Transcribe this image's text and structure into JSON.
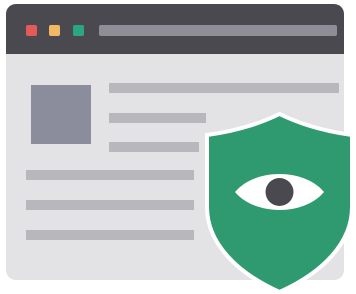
{
  "colors": {
    "window_bg": "#e3e3e6",
    "titlebar_bg": "#4a494f",
    "close_dot": "#e45a59",
    "minimize_dot": "#f2b964",
    "maximize_dot": "#2aa77e",
    "address_bar": "#8f8e96",
    "thumbnail": "#8b8c9c",
    "text_line": "#b7b7bc",
    "shield": "#2f9a70",
    "shield_border": "#ffffff",
    "eye_white": "#ffffff",
    "pupil": "#4a494f"
  },
  "icons": {
    "browser": "browser-window-icon",
    "shield": "shield-icon",
    "eye": "eye-icon"
  }
}
